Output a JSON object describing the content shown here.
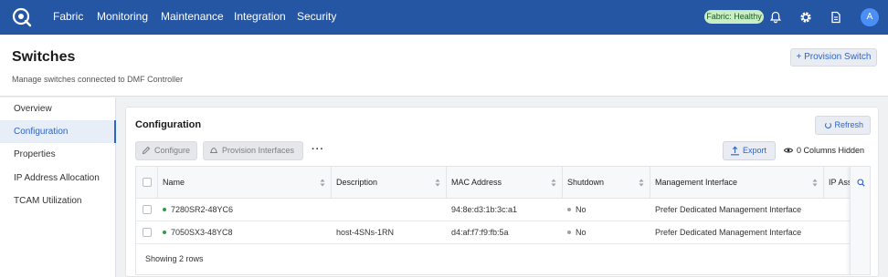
{
  "nav": {
    "items": [
      "Fabric",
      "Monitoring",
      "Maintenance",
      "Integration",
      "Security"
    ],
    "health_badge": "Fabric: Healthy",
    "avatar_initial": "A",
    "icons": [
      "bell-icon",
      "gear-icon",
      "document-icon"
    ]
  },
  "header": {
    "title": "Switches",
    "subtitle": "Manage switches connected to DMF Controller",
    "provision_button": "+ Provision Switch"
  },
  "sidebar": {
    "items": [
      "Overview",
      "Configuration",
      "Properties",
      "IP Address Allocation",
      "TCAM Utilization"
    ],
    "active": "Configuration"
  },
  "card": {
    "title": "Configuration",
    "refresh_label": "Refresh",
    "configure_label": "Configure",
    "provision_interfaces_label": "Provision Interfaces",
    "more_label": "···",
    "export_label": "Export",
    "columns_hidden": "0 Columns Hidden"
  },
  "table": {
    "columns": [
      "Name",
      "Description",
      "MAC Address",
      "Shutdown",
      "Management Interface",
      "IP Ass"
    ],
    "rows": [
      {
        "name": "7280SR2-48YC6",
        "description": "",
        "mac": "94:8e:d3:1b:3c:a1",
        "shutdown": "No",
        "mgmt": "Prefer Dedicated Management Interface"
      },
      {
        "name": "7050SX3-48YC8",
        "description": "host-4SNs-1RN",
        "mac": "d4:af:f7:f9:fb:5a",
        "shutdown": "No",
        "mgmt": "Prefer Dedicated Management Interface"
      }
    ],
    "footer": "Showing 2 rows"
  },
  "colors": {
    "nav_bg": "#2556a3",
    "accent": "#2d64c8",
    "status_green": "#2e9e44",
    "status_grey": "#9aa0a8",
    "badge_bg": "#c9eec4"
  }
}
